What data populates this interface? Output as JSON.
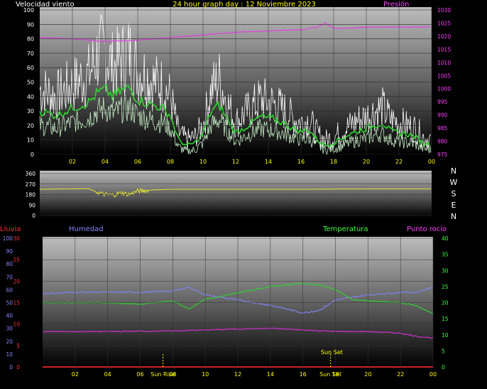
{
  "header": {
    "left_label": "Velocidad viento",
    "title": "24 hour graph day : 12 Noviembre 2023",
    "right_label": "Presión"
  },
  "colors": {
    "wind_speed": "#ffffff",
    "wind_gust": "#2dd92d",
    "wind_avg": "#c8f0c8",
    "pressure": "#e040e0",
    "direction": "#e8e832",
    "humidity": "#8080f0",
    "temperature": "#30d030",
    "dewpoint": "#d030d0",
    "rain": "#ff2020",
    "label_wind": "#ffffff",
    "label_title": "#ffff00",
    "label_pressure": "#ff40ff",
    "label_rain": "#ff3030",
    "label_humidity": "#8888ff",
    "label_temperature": "#40ff40",
    "label_dewpoint": "#ff40ff",
    "tick_axis": "#ffff00"
  },
  "compass": [
    "N",
    "W",
    "S",
    "E",
    "N"
  ],
  "bottom_labels": {
    "rain": "Lluvia",
    "humidity": "Humedad",
    "temperature": "Temperatura",
    "dewpoint": "Punto rocío",
    "sunrise": "Sun Rise",
    "sunset": "Sun Set",
    "sunset_tag": "Sun Set"
  },
  "chart_data": [
    {
      "type": "line",
      "name": "wind_pressure",
      "x_ticks": [
        "02",
        "04",
        "06",
        "08",
        "10",
        "12",
        "14",
        "16",
        "18",
        "20",
        "22",
        "00"
      ],
      "x_range_hours": [
        0,
        24
      ],
      "ylim_left": [
        0,
        100
      ],
      "y_ticks_left": [
        0,
        10,
        20,
        30,
        40,
        50,
        60,
        70,
        80,
        90,
        100
      ],
      "ylim_right": [
        975,
        1030
      ],
      "y_ticks_right": [
        975,
        980,
        985,
        990,
        995,
        1000,
        1005,
        1010,
        1015,
        1020,
        1025,
        1030
      ],
      "series": [
        {
          "key": "wind_speed_max",
          "axis": "left",
          "x": [
            0,
            1,
            2,
            3,
            3.5,
            4,
            4.5,
            5,
            5.5,
            6,
            6.5,
            7,
            7.5,
            8,
            8.5,
            9,
            9.5,
            10,
            10.5,
            11,
            11.5,
            12,
            12.5,
            13,
            13.5,
            14,
            14.5,
            15,
            15.5,
            16,
            16.5,
            17,
            17.5,
            18,
            18.5,
            19,
            19.5,
            20,
            20.5,
            21,
            21.5,
            22,
            22.5,
            23,
            23.5,
            24
          ],
          "y": [
            45,
            40,
            48,
            55,
            68,
            72,
            60,
            66,
            70,
            58,
            55,
            50,
            48,
            40,
            15,
            10,
            12,
            20,
            45,
            52,
            35,
            22,
            28,
            32,
            38,
            36,
            34,
            30,
            25,
            22,
            24,
            14,
            10,
            12,
            16,
            20,
            24,
            26,
            30,
            32,
            24,
            22,
            20,
            18,
            12,
            10
          ]
        },
        {
          "key": "wind_gust",
          "axis": "left",
          "x": [
            0,
            1,
            2,
            3,
            3.5,
            4,
            4.5,
            5,
            5.5,
            6,
            6.5,
            7,
            7.5,
            8,
            8.5,
            9,
            9.5,
            10,
            10.5,
            11,
            11.5,
            12,
            12.5,
            13,
            13.5,
            14,
            14.5,
            15,
            15.5,
            16,
            16.5,
            17,
            17.5,
            18,
            18.5,
            19,
            19.5,
            20,
            20.5,
            21,
            21.5,
            22,
            22.5,
            23,
            23.5,
            24
          ],
          "y": [
            30,
            27,
            32,
            36,
            42,
            45,
            40,
            44,
            46,
            38,
            36,
            34,
            32,
            27,
            10,
            6,
            8,
            14,
            30,
            34,
            24,
            15,
            18,
            22,
            26,
            25,
            24,
            21,
            18,
            16,
            17,
            10,
            6,
            8,
            11,
            14,
            16,
            18,
            20,
            22,
            16,
            15,
            14,
            12,
            8,
            7
          ]
        },
        {
          "key": "wind_avg",
          "axis": "left",
          "x": [
            0,
            1,
            2,
            3,
            3.5,
            4,
            4.5,
            5,
            5.5,
            6,
            6.5,
            7,
            7.5,
            8,
            8.5,
            9,
            9.5,
            10,
            10.5,
            11,
            11.5,
            12,
            12.5,
            13,
            13.5,
            14,
            14.5,
            15,
            15.5,
            16,
            16.5,
            17,
            17.5,
            18,
            18.5,
            19,
            19.5,
            20,
            20.5,
            21,
            21.5,
            22,
            22.5,
            23,
            23.5,
            24
          ],
          "y": [
            20,
            18,
            22,
            25,
            30,
            32,
            28,
            31,
            32,
            27,
            25,
            23,
            22,
            18,
            5,
            2,
            3,
            8,
            20,
            24,
            16,
            9,
            12,
            15,
            18,
            17,
            16,
            14,
            12,
            10,
            11,
            6,
            3,
            4,
            6,
            8,
            10,
            11,
            13,
            14,
            10,
            9,
            8,
            7,
            4,
            3
          ]
        },
        {
          "key": "pressure",
          "axis": "right",
          "x": [
            0,
            2,
            4,
            6,
            8,
            10,
            12,
            14,
            16,
            17,
            17.5,
            18,
            19,
            20,
            22,
            24
          ],
          "y": [
            1019.5,
            1019,
            1018,
            1018.5,
            1019.5,
            1020.5,
            1021.5,
            1022,
            1022.5,
            1023.5,
            1025,
            1023,
            1023,
            1023.5,
            1023.5,
            1023.5
          ]
        }
      ]
    },
    {
      "type": "line",
      "name": "wind_direction",
      "ylim": [
        0,
        360
      ],
      "y_ticks": [
        0,
        90,
        180,
        270,
        360
      ],
      "y_ticks_labels": [
        "0",
        "90",
        "180",
        "270",
        "360"
      ],
      "series": [
        {
          "key": "direction",
          "x": [
            0,
            3,
            3.5,
            4,
            4.5,
            5,
            5.5,
            6,
            6.5,
            7,
            8,
            12,
            16,
            20,
            24
          ],
          "y": [
            225,
            230,
            200,
            180,
            175,
            195,
            180,
            210,
            215,
            220,
            225,
            225,
            225,
            228,
            228
          ]
        }
      ]
    },
    {
      "type": "line",
      "name": "temp_humidity",
      "ylim_rain": [
        0,
        30
      ],
      "y_ticks_rain": [
        0,
        5,
        10,
        15,
        20,
        25,
        30
      ],
      "ylim_humidity": [
        0,
        100
      ],
      "y_ticks_humidity": [
        0,
        10,
        20,
        30,
        40,
        50,
        60,
        70,
        80,
        90,
        100
      ],
      "ylim_temp": [
        0,
        40
      ],
      "y_ticks_temp": [
        0,
        5,
        10,
        15,
        20,
        25,
        30,
        35,
        40
      ],
      "series": [
        {
          "key": "humidity",
          "axis": "humidity",
          "x": [
            0,
            2,
            4,
            6,
            8,
            9,
            10,
            12,
            14,
            16,
            17,
            18,
            20,
            22,
            23,
            24
          ],
          "y": [
            57,
            58,
            58,
            58,
            59,
            62,
            56,
            52,
            48,
            42,
            44,
            52,
            56,
            58,
            58,
            62
          ]
        },
        {
          "key": "temperature",
          "axis": "temp",
          "x": [
            0,
            2,
            4,
            6,
            7,
            8,
            9,
            10,
            11,
            12,
            14,
            16,
            17,
            18,
            19,
            20,
            22,
            23,
            24
          ],
          "y": [
            20,
            20,
            20,
            19.5,
            20,
            20.5,
            18,
            21,
            22,
            23,
            25,
            26,
            25.5,
            24,
            21,
            20.5,
            20,
            19,
            16.5
          ]
        },
        {
          "key": "dewpoint",
          "axis": "temp",
          "x": [
            0,
            4,
            8,
            10,
            12,
            14,
            16,
            18,
            20,
            22,
            23,
            24
          ],
          "y": [
            11,
            11,
            11.2,
            11.5,
            11.8,
            12,
            11.5,
            11,
            11,
            10.5,
            9.5,
            9
          ]
        },
        {
          "key": "rain",
          "axis": "rain",
          "x": [
            0,
            24
          ],
          "y": [
            0,
            0
          ]
        }
      ],
      "sunrise_hour": 7.4,
      "sunset_hour": 17.7
    }
  ]
}
